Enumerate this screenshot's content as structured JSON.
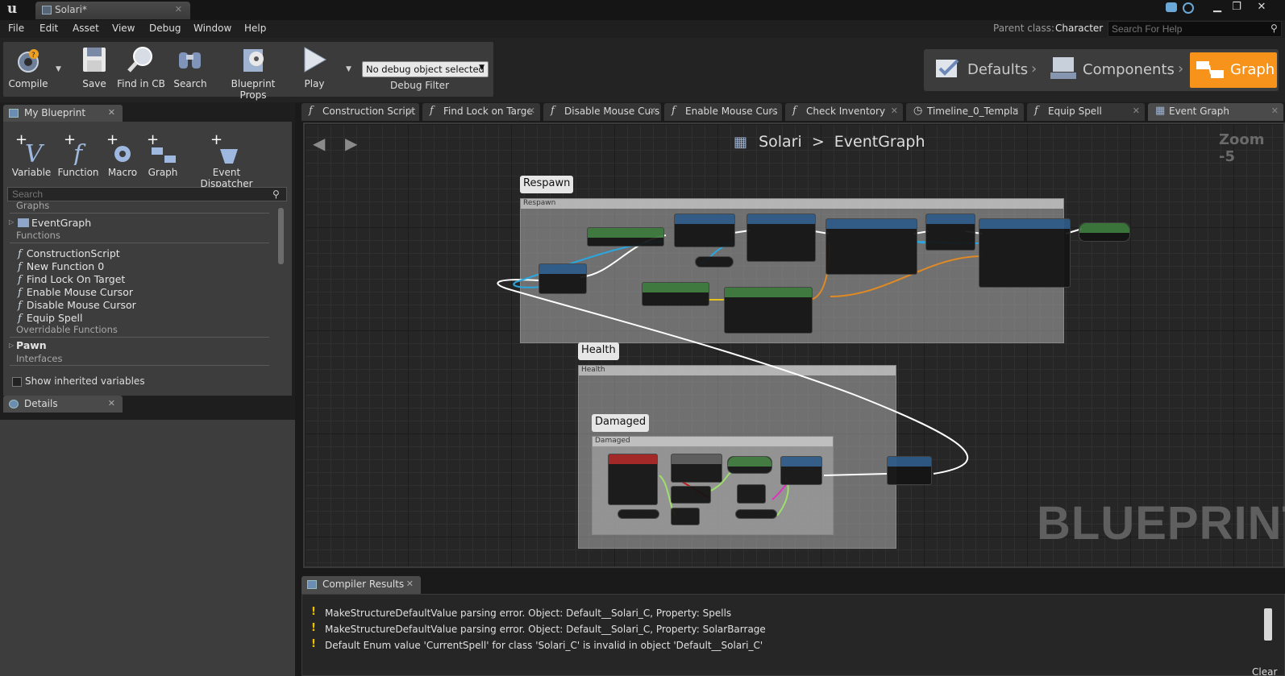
{
  "window": {
    "tab_title": "Solari*"
  },
  "menu": [
    "File",
    "Edit",
    "Asset",
    "View",
    "Debug",
    "Window",
    "Help"
  ],
  "parent_class": {
    "label": "Parent class:",
    "value": "Character"
  },
  "help_search_placeholder": "Search For Help",
  "toolbar": {
    "compile": "Compile",
    "save": "Save",
    "find_in_cb": "Find in CB",
    "search": "Search",
    "blueprint_props": "Blueprint Props",
    "play": "Play",
    "debug_select": "No debug object selected",
    "debug_filter": "Debug Filter"
  },
  "modes": {
    "defaults": "Defaults",
    "components": "Components",
    "graph": "Graph"
  },
  "my_blueprint": {
    "tab": "My Blueprint",
    "add": [
      "Variable",
      "Function",
      "Macro",
      "Graph",
      "Event Dispatcher"
    ],
    "search_placeholder": "Search",
    "graphs_label": "Graphs",
    "event_graph": "EventGraph",
    "functions_label": "Functions",
    "functions": [
      "ConstructionScript",
      "New Function 0",
      "Find Lock On Target",
      "Enable Mouse Cursor",
      "Disable Mouse Cursor",
      "Equip Spell"
    ],
    "overridable_label": "Overridable Functions",
    "pawn": "Pawn",
    "interfaces_label": "Interfaces",
    "show_inherited": "Show inherited variables"
  },
  "details": {
    "tab": "Details"
  },
  "graph_tabs": [
    "Construction Script",
    "Find Lock on Targe",
    "Disable Mouse Curs",
    "Enable Mouse Curs",
    "Check Inventory",
    "Timeline_0_Templa",
    "Equip Spell",
    "Event Graph"
  ],
  "breadcrumb": {
    "root": "Solari",
    "sep": ">",
    "current": "EventGraph"
  },
  "zoom": "Zoom -5",
  "watermark": "BLUEPRINT",
  "comments": {
    "respawn": "Respawn",
    "health": "Health",
    "damaged": "Damaged"
  },
  "compiler": {
    "tab": "Compiler Results",
    "lines": [
      "MakeStructureDefaultValue parsing error. Object: Default__Solari_C, Property: Spells",
      "MakeStructureDefaultValue parsing error. Object: Default__Solari_C, Property: SolarBarrage",
      "Default Enum value 'CurrentSpell' for class 'Solari_C' is invalid in object 'Default__Solari_C'"
    ],
    "warn_glyph": "!",
    "clear": "Clear"
  },
  "colors": {
    "accent_graph": "#f7931a",
    "warning": "#f0c000",
    "exec_wire": "#ffffff",
    "object_wire": "#2aa6e0",
    "struct_wire": "#e08a24"
  }
}
